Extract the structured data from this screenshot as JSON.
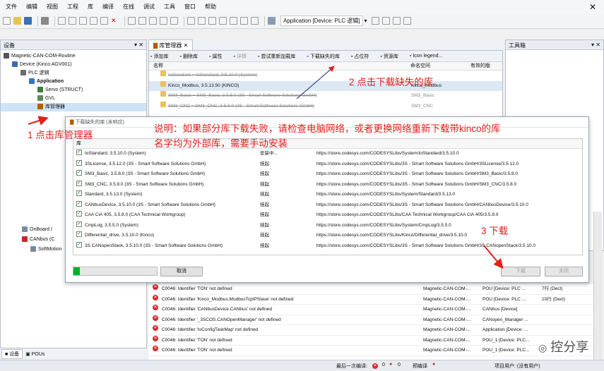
{
  "menu": [
    "文件",
    "编辑",
    "视图",
    "工程",
    "库",
    "编译",
    "在线",
    "调试",
    "工具",
    "窗口",
    "帮助"
  ],
  "toolbar": {
    "application_label": "Application [Device: PLC 逻辑]"
  },
  "devices_panel": {
    "title": "设备",
    "tree": [
      {
        "label": "Magnetic-CAN-COM-Routine",
        "indent": 0,
        "icon": "project-icon"
      },
      {
        "label": "Device (Kinco AGV001)",
        "indent": 1,
        "icon": "device-icon"
      },
      {
        "label": "PLC 逻辑",
        "indent": 2,
        "icon": "plc-icon"
      },
      {
        "label": "Application",
        "indent": 3,
        "icon": "application-icon"
      },
      {
        "label": "Servo (STRUCT)",
        "indent": 4,
        "icon": "struct-icon"
      },
      {
        "label": "GVL",
        "indent": 4,
        "icon": "gvl-icon"
      },
      {
        "label": "库管理器",
        "indent": 4,
        "icon": "library-icon"
      }
    ],
    "tree_lower": [
      {
        "label": "OnBoard I",
        "icon": "io-icon"
      },
      {
        "label": "CANbus (C",
        "icon": "canbus-icon"
      },
      {
        "label": "SoftMotion",
        "icon": "motion-icon"
      }
    ],
    "bottom_tabs": [
      "设备",
      "POUs"
    ]
  },
  "library_manager": {
    "tab_label": "库管理器",
    "buttons": [
      "添加库",
      "删除库",
      "属性",
      "详情",
      "尝试重新加载库",
      "下载缺失的库",
      "占位符",
      "资源库",
      "Icon legend..."
    ],
    "columns": [
      "名称",
      "命名空间",
      "有效的版"
    ],
    "rows": [
      {
        "name": "IoStandard = IoStandard, 3.5.10.0 (System)",
        "ns": "",
        "strike": true
      },
      {
        "name": "Kinco_Modbus, 3.5.13.50 (KINCO)",
        "ns": "Kinco_Modbus",
        "strike": false
      },
      {
        "name": "SM3_Basic = SM3_Basic, 3.5.8.0 (3S - Smart Software Solutions GmbH)",
        "ns": "SM3_Basic",
        "strike": true
      },
      {
        "name": "SM3_CNC = SM3_CNC, 3.5.8.0 (3S - Smart Software Solutions GmbH)",
        "ns": "SM3_CNC",
        "strike": true
      },
      {
        "name": "",
        "ns": "",
        "strike": false
      }
    ]
  },
  "toolbox": {
    "title": "工具箱"
  },
  "messages": [
    {
      "text": "C0046: Identifier 'TON' not defined",
      "project": "Magnetic-CAN-COM-...",
      "obj": "POU [Device: PLC ...",
      "pos": "7行 (Decl)"
    },
    {
      "text": "C0046: Identifier 'Kinco_Modbus.ModbusTcpIPSlave' not defined",
      "project": "Magnetic-CAN-COM-...",
      "obj": "POU [Device: PLC ...",
      "pos": "10行 (Decl)"
    },
    {
      "text": "C0046: Identifier 'CANbusDevice.CANbus' not defined",
      "project": "Magnetic-CAN-COM-...",
      "obj": "CANbus [Device]",
      "pos": ""
    },
    {
      "text": "C0046: Identifier '_3SCOS.CANOpenManager' not defined",
      "project": "Magnetic-CAN-COM-...",
      "obj": "CANopen_Manager ...",
      "pos": ""
    },
    {
      "text": "C0046: Identifier 'IoConfigTaskMap' not defined",
      "project": "Magnetic-CAN-COM-...",
      "obj": "Application [Device: ...",
      "pos": ""
    },
    {
      "text": "C0046: Identifier 'TON' not defined",
      "project": "Magnetic-CAN-COM-...",
      "obj": "POU_1 [Device: PLC...",
      "pos": ""
    },
    {
      "text": "C0046: Identifier 'TON' not defined",
      "project": "Magnetic-CAN-COM-...",
      "obj": "POU_1 [Device: PLC...",
      "pos": ""
    }
  ],
  "dialog": {
    "title": "下载缺失的库 (未响应)",
    "header": "库",
    "rows": [
      {
        "lib": "IoStandard, 3.5.10.0 (System)",
        "status": "安装中...",
        "url": "https://store.codesys.com/CODESYSLibs/System/IoStandard/3.5.10.0"
      },
      {
        "lib": "3SLicense, 3.5.12.0 (3S - Smart Software Solutions GmbH)",
        "status": "挂起",
        "url": "https://store.codesys.com/CODESYSLibs/3S - Smart Software Solutions GmbH/3SLicense/3.5.12.0"
      },
      {
        "lib": "SM3_Basic, 3.5.8.0 (3S - Smart Software Solutions GmbH)",
        "status": "挂起",
        "url": "https://store.codesys.com/CODESYSLibs/3S - Smart Software Solutions GmbH/SM3_Basic/3.5.8.0"
      },
      {
        "lib": "SM3_CNC, 3.5.8.0 (3S - Smart Software Solutions GmbH)",
        "status": "挂起",
        "url": "https://store.codesys.com/CODESYSLibs/3S - Smart Software Solutions GmbH/SM3_CNC/3.5.8.0"
      },
      {
        "lib": "Standard, 3.5.13.0 (System)",
        "status": "挂起",
        "url": "https://store.codesys.com/CODESYSLibs/System/Standard/3.5.13.0"
      },
      {
        "lib": "CANbusDevice, 3.5.10.0 (3S - Smart Software Solutions GmbH)",
        "status": "挂起",
        "url": "https://store.codesys.com/CODESYSLibs/3S - Smart Software Solutions GmbH/CANbusDevice/3.5.10.0"
      },
      {
        "lib": "CAA CiA 405, 3.5.8.0 (CAA Technical Workgroup)",
        "status": "挂起",
        "url": "https://store.codesys.com/CODESYSLibs/CAA Technical Workgroup/CAA CiA 405/3.5.8.0"
      },
      {
        "lib": "CmpLog, 3.5.5.0 (System)",
        "status": "挂起",
        "url": "https://store.codesys.com/CODESYSLibs/System/CmpLog/3.5.5.0"
      },
      {
        "lib": "Differential_drive, 3.5.10.0 (Kinco)",
        "status": "挂起",
        "url": "https://store.codesys.com/CODESYSLibs/Kinco/Differential_drive/3.5.10.0"
      },
      {
        "lib": "3S CANopenStack, 3.5.10.0 (3S - Smart Software Solutions GmbH)",
        "status": "挂起",
        "url": "https://store.codesys.com/CODESYSLibs/3S - Smart Software Solutions GmbH/3S CANopenStack/3.5.10.0"
      }
    ],
    "progress": 0.08,
    "cancel_label": "取消",
    "download_label": "下载",
    "close_label": "关闭"
  },
  "annotations": {
    "note": "说明：如果部分库下载失败，请检查电脑网络，或者更换网络重新下载带kinco的库名字均为外部库，需要手动安装",
    "step1": "1 点击库管理器",
    "step2": "2 点击下载缺失的库",
    "step3": "3 下载"
  },
  "statusbar": {
    "last_compile": "最后一次编译:",
    "err_count": "0",
    "warn_count": "0",
    "precompile": "预编译",
    "project_user": "项目用户: (没有用户)"
  },
  "watermark": "控分享",
  "colors": {
    "accent": "#e0211d",
    "error": "#d12b2b",
    "check": "#1b6e1b"
  }
}
